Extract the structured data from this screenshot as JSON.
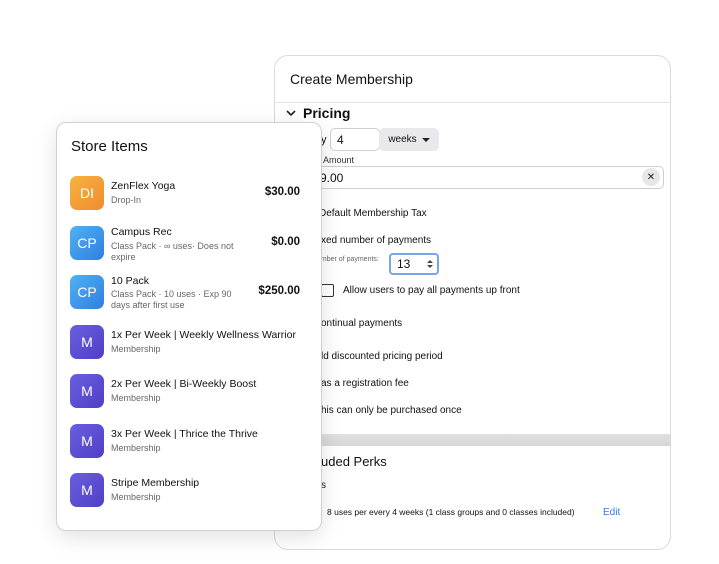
{
  "membership": {
    "title": "Create Membership",
    "pricing_title": "Pricing",
    "every_label": "y",
    "every_value": "4",
    "period_select": "weeks",
    "amount_label": "Amount",
    "amount_value": "9.00",
    "clear_icon": "✕",
    "tax_label": "Default Membership Tax",
    "fixed_payments_label": "xed number of payments",
    "num_payments_label": "umber of payments:",
    "num_payments_value": "13",
    "pay_upfront_label": "Allow users to pay all payments up front",
    "continual_label": "ontinual payments",
    "discount_label": "ld discounted pricing period",
    "registration_label": "as a registration fee",
    "once_label": "his can only be purchased once",
    "perks_title": "uded Perks",
    "perks_sub": "s",
    "perk_text": "8 uses per every 4 weeks (1 class groups and 0 classes included)",
    "edit_label": "Edit"
  },
  "store": {
    "title": "Store Items",
    "items": [
      {
        "initials": "DI",
        "name": "ZenFlex Yoga",
        "sub": "Drop-In",
        "price": "$30.00",
        "color": "#f4a13a"
      },
      {
        "initials": "CP",
        "name": "Campus Rec",
        "sub": "Class Pack · ∞ uses· Does not expire",
        "price": "$0.00",
        "color": "#3e9aeb"
      },
      {
        "initials": "CP",
        "name": "10 Pack",
        "sub": "Class Pack · 10 uses · Exp 90 days after first use",
        "price": "$250.00",
        "color": "#3e9aeb"
      },
      {
        "initials": "M",
        "name": "1x Per Week | Weekly Wellness Warrior",
        "sub": "Membership",
        "price": "",
        "color": "#5a4fd6"
      },
      {
        "initials": "M",
        "name": "2x Per Week | Bi-Weekly Boost",
        "sub": "Membership",
        "price": "",
        "color": "#5a4fd6"
      },
      {
        "initials": "M",
        "name": "3x Per Week | Thrice the Thrive",
        "sub": "Membership",
        "price": "",
        "color": "#5a4fd6"
      },
      {
        "initials": "M",
        "name": "Stripe Membership",
        "sub": "Membership",
        "price": "",
        "color": "#5a4fd6"
      }
    ]
  }
}
